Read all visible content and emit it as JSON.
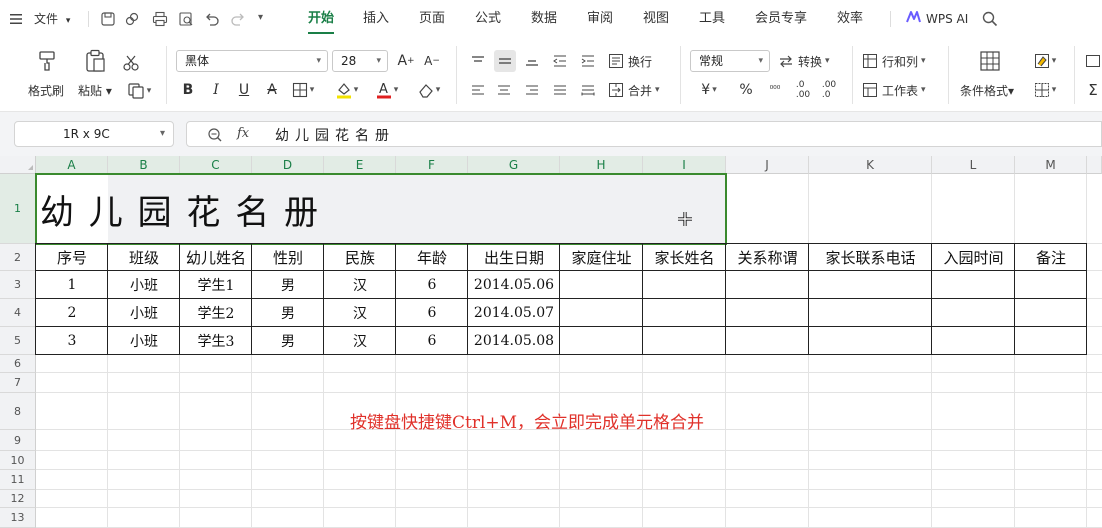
{
  "menubar": {
    "file_label": "文件",
    "tabs": [
      "开始",
      "插入",
      "页面",
      "公式",
      "数据",
      "审阅",
      "视图",
      "工具",
      "会员专享",
      "效率"
    ],
    "active_tab": "开始",
    "wps_ai": "WPS AI"
  },
  "ribbon": {
    "format_painter": "格式刷",
    "paste": "粘贴",
    "font_name": "黑体",
    "font_size": "28",
    "wrap": "换行",
    "merge": "合并",
    "number_format": "常规",
    "convert": "转换",
    "row_col": "行和列",
    "worksheet": "工作表",
    "cond_format": "条件格式",
    "percent": "%"
  },
  "formulabar": {
    "namebox": "1R x 9C",
    "fx": "fx",
    "content": "幼儿园花名册"
  },
  "grid": {
    "columns": [
      "A",
      "B",
      "C",
      "D",
      "E",
      "F",
      "G",
      "H",
      "I",
      "J",
      "K",
      "L",
      "M"
    ],
    "rows": [
      "1",
      "2",
      "3",
      "4",
      "5",
      "6",
      "7",
      "8",
      "9",
      "10",
      "11",
      "12",
      "13"
    ],
    "title": "幼 儿 园 花 名 册",
    "headers": [
      "序号",
      "班级",
      "幼儿姓名",
      "性别",
      "民族",
      "年龄",
      "出生日期",
      "家庭住址",
      "家长姓名",
      "关系称谓",
      "家长联系电话",
      "入园时间",
      "备注"
    ],
    "data_rows": [
      [
        "1",
        "小班",
        "学生1",
        "男",
        "汉",
        "6",
        "2014.05.06",
        "",
        "",
        "",
        "",
        "",
        ""
      ],
      [
        "2",
        "小班",
        "学生2",
        "男",
        "汉",
        "6",
        "2014.05.07",
        "",
        "",
        "",
        "",
        "",
        ""
      ],
      [
        "3",
        "小班",
        "学生3",
        "男",
        "汉",
        "6",
        "2014.05.08",
        "",
        "",
        "",
        "",
        "",
        ""
      ]
    ],
    "note": "按键盘快捷键Ctrl+M，会立即完成单元格合并",
    "note_color": "#e0312a",
    "selection_color": "#3a8a2e"
  }
}
